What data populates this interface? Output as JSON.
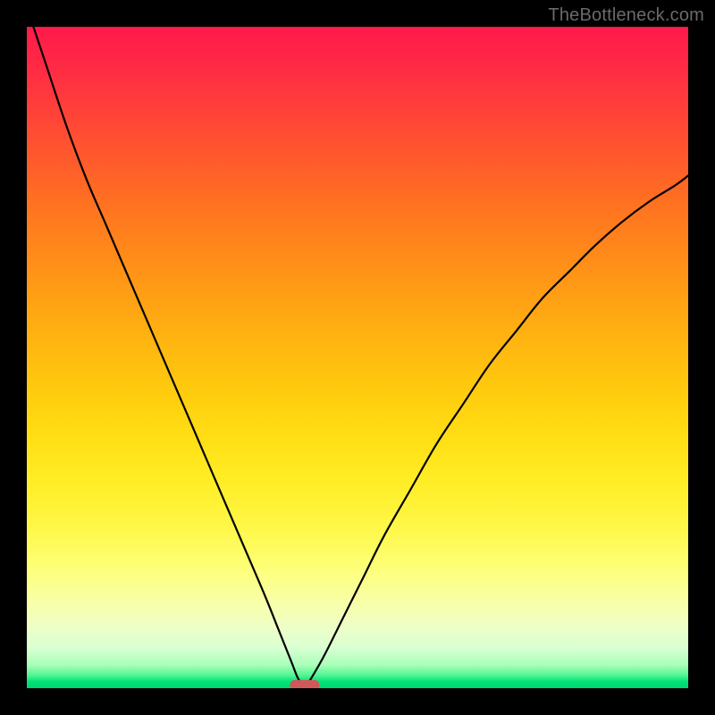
{
  "watermark": "TheBottleneck.com",
  "colors": {
    "frame": "#000000",
    "curve": "#000000",
    "marker": "#d0585a"
  },
  "chart_data": {
    "type": "line",
    "title": "",
    "xlabel": "",
    "ylabel": "",
    "xlim": [
      0,
      100
    ],
    "ylim": [
      0,
      100
    ],
    "optimum_x": 42,
    "marker": {
      "x": 42,
      "y": 0.5,
      "w": 4.5,
      "h": 1.4
    },
    "series": [
      {
        "name": "left-branch",
        "x": [
          1,
          3,
          6,
          9,
          12,
          15,
          18,
          21,
          24,
          27,
          30,
          33,
          36,
          38,
          40,
          41,
          42
        ],
        "values": [
          100,
          94,
          85,
          77,
          70,
          63,
          56,
          49,
          42,
          35,
          28,
          21,
          14,
          9,
          4,
          1.5,
          0
        ]
      },
      {
        "name": "right-branch",
        "x": [
          42,
          43,
          45,
          48,
          51,
          54,
          58,
          62,
          66,
          70,
          74,
          78,
          82,
          86,
          90,
          94,
          98,
          100
        ],
        "values": [
          0,
          1.5,
          5,
          11,
          17,
          23,
          30,
          37,
          43,
          49,
          54,
          59,
          63,
          67,
          70.5,
          73.5,
          76,
          77.5
        ]
      }
    ]
  }
}
